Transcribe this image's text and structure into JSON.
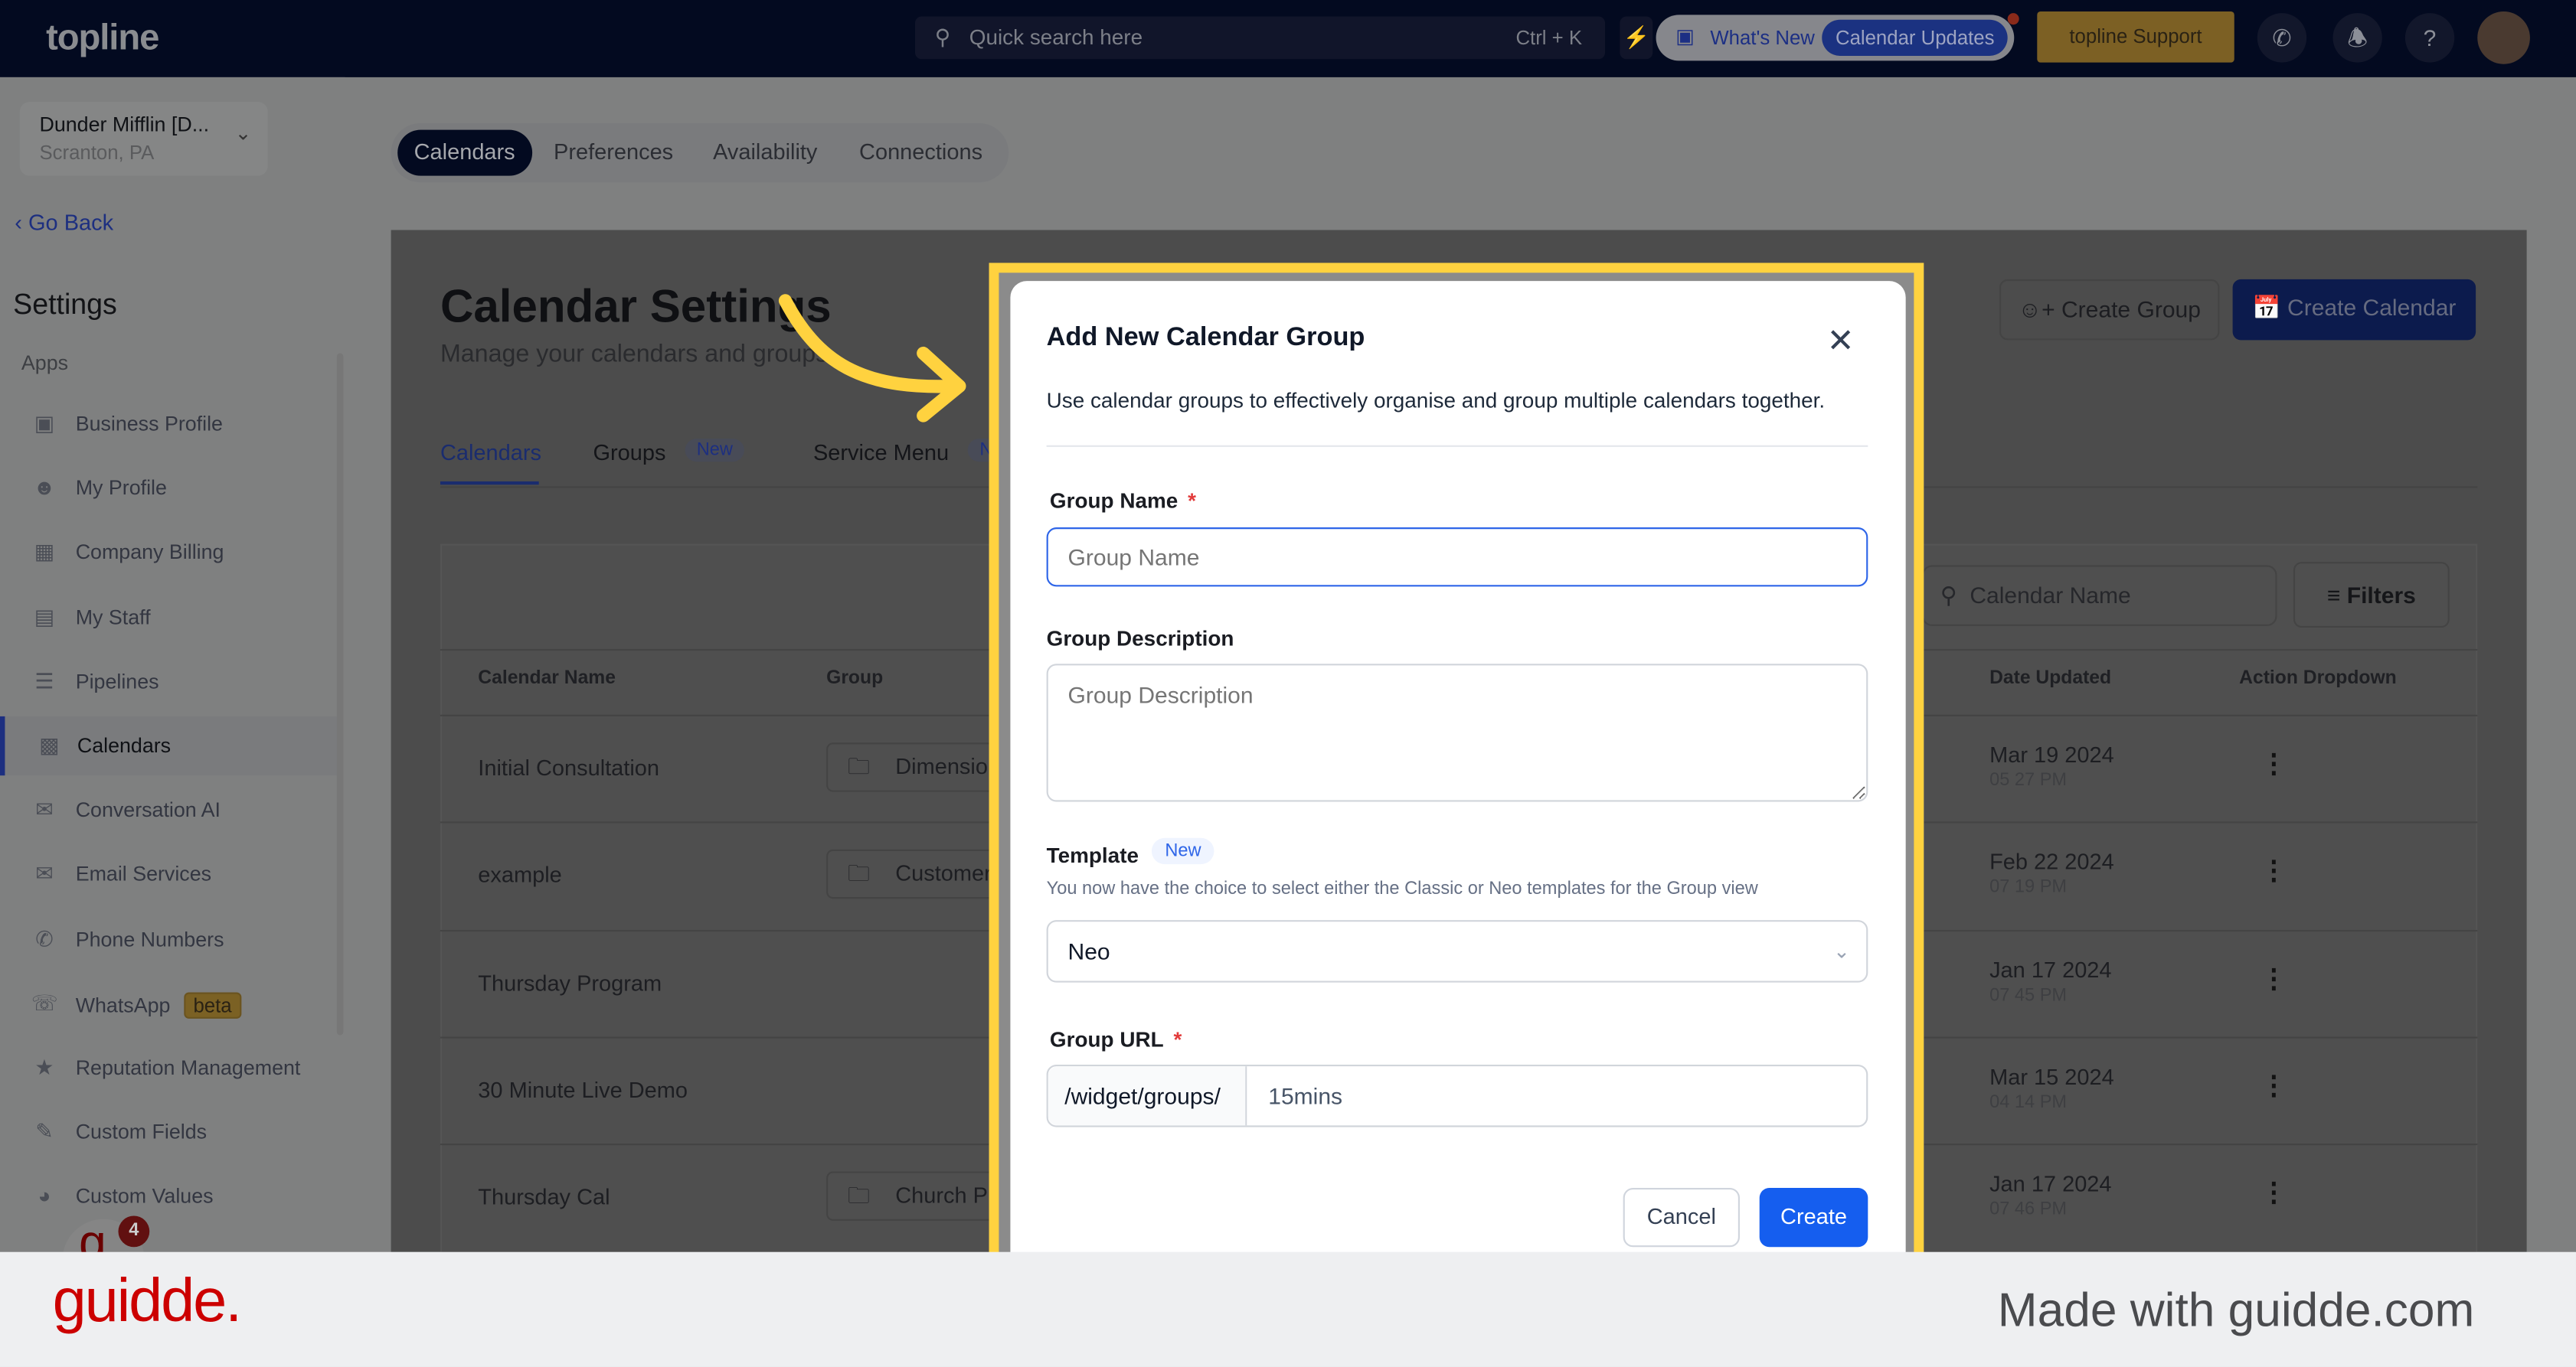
{
  "header": {
    "logo": "topline",
    "search_placeholder": "Quick search here",
    "search_shortcut": "Ctrl + K",
    "whats_new": "What's New",
    "calendar_updates": "Calendar Updates",
    "support": "topline Support",
    "icons": [
      "search-icon",
      "lightning-icon",
      "phone-icon",
      "bell-icon",
      "help-icon",
      "avatar"
    ]
  },
  "sidebar": {
    "account_name": "Dunder Mifflin [D...",
    "account_location": "Scranton, PA",
    "go_back": "Go Back",
    "title": "Settings",
    "section": "Apps",
    "items": [
      {
        "label": "Business Profile",
        "icon": "briefcase-icon"
      },
      {
        "label": "My Profile",
        "icon": "user-icon"
      },
      {
        "label": "Company Billing",
        "icon": "grid-icon"
      },
      {
        "label": "My Staff",
        "icon": "staff-icon"
      },
      {
        "label": "Pipelines",
        "icon": "pipeline-icon"
      },
      {
        "label": "Calendars",
        "icon": "calendar-icon",
        "active": true
      },
      {
        "label": "Conversation AI",
        "icon": "chat-icon"
      },
      {
        "label": "Email Services",
        "icon": "mail-icon"
      },
      {
        "label": "Phone Numbers",
        "icon": "phone-icon"
      },
      {
        "label": "WhatsApp",
        "icon": "whatsapp-icon",
        "badge": "beta"
      },
      {
        "label": "Reputation Management",
        "icon": "star-icon"
      },
      {
        "label": "Custom Fields",
        "icon": "edit-icon"
      },
      {
        "label": "Custom Values",
        "icon": "pie-icon"
      }
    ],
    "guidde_badge": "4"
  },
  "top_tabs": [
    "Calendars",
    "Preferences",
    "Availability",
    "Connections"
  ],
  "page": {
    "title": "Calendar Settings",
    "subtitle": "Manage your calendars and groups",
    "create_group": "Create Group",
    "create_calendar": "Create Calendar",
    "tabs": [
      {
        "label": "Calendars"
      },
      {
        "label": "Groups",
        "badge": "New"
      },
      {
        "label": "Service Menu",
        "badge": "New"
      }
    ],
    "search_placeholder": "Calendar Name",
    "filters": "Filters",
    "columns": [
      "Calendar Name",
      "Group",
      "Date Updated",
      "Action Dropdown"
    ],
    "rows": [
      {
        "name": "Initial Consultation",
        "group": "Dimension A",
        "date": "Mar 19 2024",
        "time": "05 27 PM"
      },
      {
        "name": "example",
        "group": "Customer S",
        "date": "Feb 22 2024",
        "time": "07 19 PM"
      },
      {
        "name": "Thursday Program",
        "group": "",
        "date": "Jan 17 2024",
        "time": "07 45 PM"
      },
      {
        "name": "30 Minute Live Demo",
        "group": "",
        "date": "Mar 15 2024",
        "time": "04 14 PM"
      },
      {
        "name": "Thursday Cal",
        "group": "Church Pro",
        "date": "Jan 17 2024",
        "time": "07 46 PM"
      }
    ]
  },
  "modal": {
    "title": "Add New Calendar Group",
    "description": "Use calendar groups to effectively organise and group multiple calendars together.",
    "group_name_label": "Group Name",
    "group_name_placeholder": "Group Name",
    "group_desc_label": "Group Description",
    "group_desc_placeholder": "Group Description",
    "template_label": "Template",
    "template_badge": "New",
    "template_help": "You now have the choice to select either the Classic or Neo templates for the Group view",
    "template_value": "Neo",
    "url_label": "Group URL",
    "url_prefix": "/widget/groups/",
    "url_value": "15mins",
    "required": "*",
    "cancel": "Cancel",
    "create": "Create"
  },
  "footer": {
    "logo": "guidde.",
    "made_with": "Made with guidde.com"
  },
  "colors": {
    "highlight": "#ffd23f",
    "primary": "#155eef",
    "brand_red": "#cc0000"
  }
}
